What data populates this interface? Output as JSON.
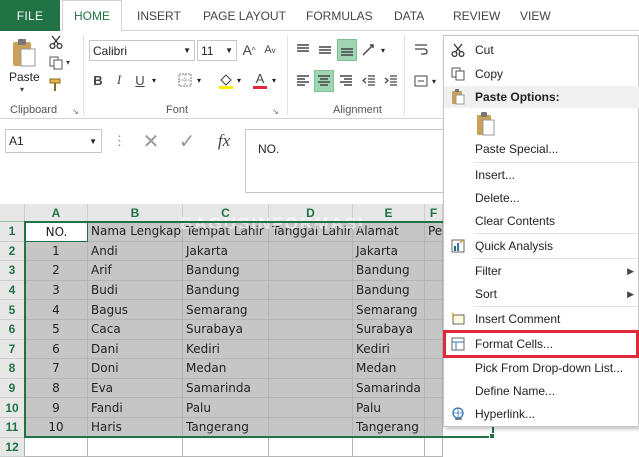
{
  "tabs": {
    "file": "FILE",
    "home": "HOME",
    "insert": "INSERT",
    "page_layout": "PAGE LAYOUT",
    "formulas": "FORMULAS",
    "data": "DATA",
    "review": "REVIEW",
    "view": "VIEW"
  },
  "ribbon": {
    "clipboard": {
      "label": "Clipboard",
      "paste": "Paste"
    },
    "font": {
      "label": "Font",
      "family": "Calibri",
      "size": "11",
      "bold": "B",
      "italic": "I",
      "underline": "U",
      "grow": "A",
      "shrink": "A",
      "font_color": "A"
    },
    "alignment": {
      "label": "Alignment"
    }
  },
  "formula_bar": {
    "name_box": "A1",
    "fx": "fx",
    "content": "NO."
  },
  "columns": [
    "A",
    "B",
    "C",
    "D",
    "E",
    "F"
  ],
  "header_row": [
    "NO.",
    "Nama Lengkap",
    "Tempat Lahir",
    "Tanggal Lahir",
    "Alamat",
    "Pe"
  ],
  "rows": [
    {
      "num": "1",
      "name": "Andi",
      "place": "Jakarta",
      "date": "",
      "addr": "Jakarta"
    },
    {
      "num": "2",
      "name": "Arif",
      "place": "Bandung",
      "date": "",
      "addr": "Bandung"
    },
    {
      "num": "3",
      "name": "Budi",
      "place": "Bandung",
      "date": "",
      "addr": "Bandung"
    },
    {
      "num": "4",
      "name": "Bagus",
      "place": "Semarang",
      "date": "",
      "addr": "Semarang"
    },
    {
      "num": "5",
      "name": "Caca",
      "place": "Surabaya",
      "date": "",
      "addr": "Surabaya"
    },
    {
      "num": "6",
      "name": "Dani",
      "place": "Kediri",
      "date": "",
      "addr": "Kediri"
    },
    {
      "num": "7",
      "name": "Doni",
      "place": "Medan",
      "date": "",
      "addr": "Medan"
    },
    {
      "num": "8",
      "name": "Eva",
      "place": "Samarinda",
      "date": "",
      "addr": "Samarinda"
    },
    {
      "num": "9",
      "name": "Fandi",
      "place": "Palu",
      "date": "",
      "addr": "Palu"
    },
    {
      "num": "10",
      "name": "Haris",
      "place": "Tangerang",
      "date": "",
      "addr": "Tangerang"
    }
  ],
  "row_numbers": [
    "1",
    "2",
    "3",
    "4",
    "5",
    "6",
    "7",
    "8",
    "9",
    "10",
    "11",
    "12"
  ],
  "watermark": "BAGUSINFORMASI",
  "context_menu": {
    "cut": "Cut",
    "copy": "Copy",
    "paste_options": "Paste Options:",
    "paste_special": "Paste Special...",
    "insert": "Insert...",
    "delete": "Delete...",
    "clear_contents": "Clear Contents",
    "quick_analysis": "Quick Analysis",
    "filter": "Filter",
    "sort": "Sort",
    "insert_comment": "Insert Comment",
    "format_cells": "Format Cells...",
    "pick_list": "Pick From Drop-down List...",
    "define_name": "Define Name...",
    "hyperlink": "Hyperlink..."
  },
  "colors": {
    "accent": "#217346",
    "highlight_box": "#e0283c",
    "selection": "#c6c6c6"
  }
}
